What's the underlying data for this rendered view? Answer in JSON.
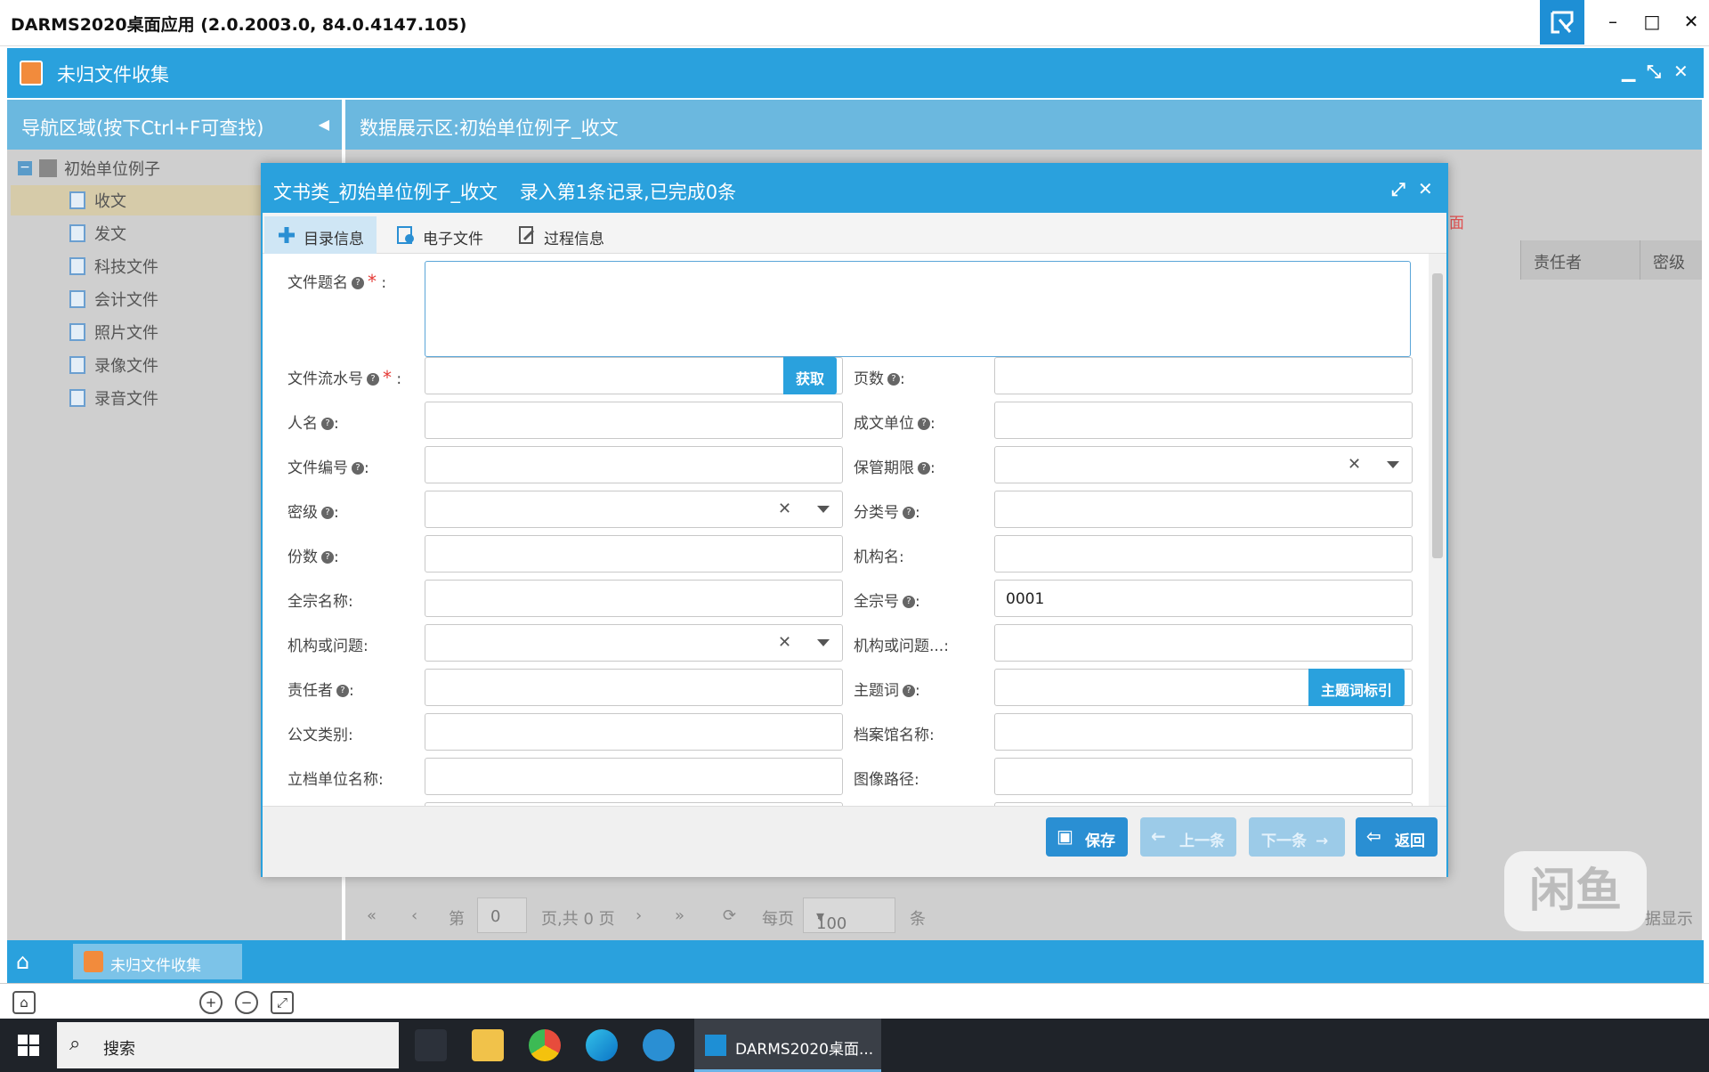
{
  "window": {
    "title": "DARMS2020桌面应用 (2.0.2003.0, 84.0.4147.105)"
  },
  "module": {
    "title": "未归文件收集"
  },
  "nav": {
    "header": "导航区域(按下Ctrl+F可查找)",
    "root": "初始单位例子",
    "items": [
      {
        "label": "收文",
        "selected": true
      },
      {
        "label": "发文"
      },
      {
        "label": "科技文件"
      },
      {
        "label": "会计文件"
      },
      {
        "label": "照片文件"
      },
      {
        "label": "录像文件"
      },
      {
        "label": "录音文件"
      }
    ]
  },
  "data_region": {
    "header": "数据展示区:初始单位例子_收文",
    "columns": [
      "责任者",
      "密级"
    ],
    "pager": {
      "page_label": "第",
      "page_value": "0",
      "total": "页,共 0 页",
      "per_page_label": "每页",
      "per_page_value": "100",
      "unit": "条"
    },
    "clipped_text": {
      "red_fragment": "面",
      "right_fragment": "据显示"
    }
  },
  "modal": {
    "title": "文书类_初始单位例子_收文",
    "status": "录入第1条记录,已完成0条",
    "tabs": [
      "目录信息",
      "电子文件",
      "过程信息"
    ],
    "fields": {
      "title_label": "文件题名",
      "serial_label": "文件流水号",
      "serial_button": "获取",
      "pages_label": "页数",
      "person_label": "人名",
      "issuer_label": "成文单位",
      "docno_label": "文件编号",
      "retention_label": "保管期限",
      "secret_label": "密级",
      "classno_label": "分类号",
      "copies_label": "份数",
      "org_label": "机构名:",
      "fonds_name_label": "全宗名称:",
      "fonds_no_label": "全宗号",
      "fonds_no_value": "0001",
      "org_issue_label": "机构或问题:",
      "org_issue2_label": "机构或问题...:",
      "responsible_label": "责任者",
      "subject_label": "主题词",
      "subject_button": "主题词标引",
      "doc_category_label": "公文类别:",
      "archive_name_label": "档案馆名称:",
      "filing_unit_label": "立档单位名称:",
      "image_path_label": "图像路径:"
    },
    "buttons": {
      "save": "保存",
      "prev": "上一条",
      "next": "下一条",
      "back": "返回"
    }
  },
  "app_taskbar": {
    "tab": "未归文件收集"
  },
  "win_taskbar": {
    "search": "搜索",
    "active_app": "DARMS2020桌面..."
  },
  "watermark": "闲鱼"
}
